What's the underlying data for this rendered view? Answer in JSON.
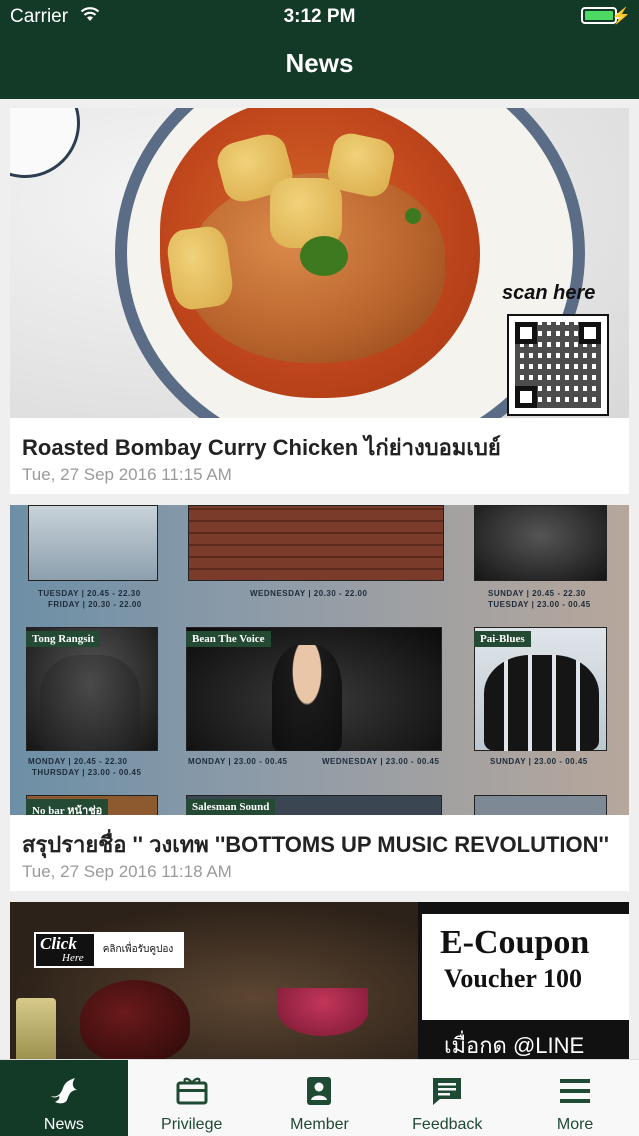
{
  "status_bar": {
    "carrier": "Carrier",
    "time": "3:12 PM",
    "battery_icon": "battery-full-charging-icon",
    "wifi_icon": "wifi-icon"
  },
  "nav": {
    "title": "News"
  },
  "news": [
    {
      "title": "Roasted Bombay Curry Chicken ไก่ย่างบอมเบย์",
      "date": "Tue, 27 Sep 2016 11:15 AM",
      "image": {
        "scan_text": "scan here"
      }
    },
    {
      "title": "สรุปรายชื่อ '' วงเทพ ''BOTTOMS UP MUSIC REVOLUTION''",
      "date": "Tue, 27 Sep 2016 11:18 AM",
      "image": {
        "tags": [
          "Tong Rangsit",
          "Bean The Voice",
          "Pai-Blues",
          "No bar หน้าช่อ",
          "Salesman Sound"
        ],
        "schedules": [
          "TUESDAY | 20.45 - 22.30",
          "FRIDAY | 20.30 - 22.00",
          "WEDNESDAY | 20.30 - 22.00",
          "SUNDAY | 20.45 - 22.30",
          "TUESDAY | 23.00 - 00.45",
          "MONDAY | 20.45 - 22.30",
          "THURSDAY | 23.00 - 00.45",
          "MONDAY | 23.00 - 00.45",
          "WEDNESDAY | 23.00 - 00.45",
          "SUNDAY | 23.00 - 00.45"
        ]
      }
    },
    {
      "image": {
        "click_line1": "Click",
        "click_line2": "Here",
        "click_thai": "คลิกเพื่อรับคูปอง",
        "coupon_title": "E-Coupon",
        "coupon_sub": "Voucher 100",
        "coupon_bottom": "เมื่อกด @LINE"
      }
    }
  ],
  "tab_bar": {
    "tabs": [
      {
        "label": "News",
        "icon": "bird-icon",
        "active": true
      },
      {
        "label": "Privilege",
        "icon": "gift-card-icon",
        "active": false
      },
      {
        "label": "Member",
        "icon": "member-card-icon",
        "active": false
      },
      {
        "label": "Feedback",
        "icon": "chat-feedback-icon",
        "active": false
      },
      {
        "label": "More",
        "icon": "menu-icon",
        "active": false
      }
    ]
  },
  "colors": {
    "brand_green": "#133a26",
    "battery_green": "#4cd964",
    "date_gray": "#9a9a9a"
  }
}
